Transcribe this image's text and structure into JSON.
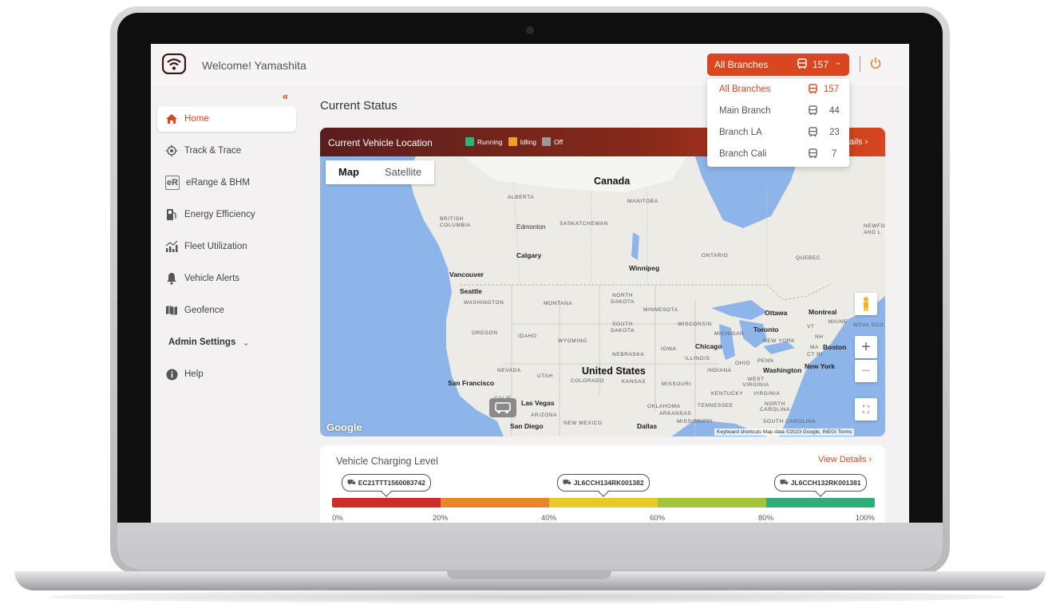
{
  "header": {
    "welcome": "Welcome! Yamashita",
    "branch_selector": {
      "label": "All Branches",
      "count": "157"
    }
  },
  "dropdown": {
    "items": [
      {
        "name": "All Branches",
        "count": "157",
        "selected": true
      },
      {
        "name": "Main Branch",
        "count": "44"
      },
      {
        "name": "Branch LA",
        "count": "23"
      },
      {
        "name": "Branch Cali",
        "count": "7"
      }
    ]
  },
  "sidebar": {
    "collapse": "«",
    "items": [
      {
        "label": "Home",
        "icon": "home-icon",
        "active": true
      },
      {
        "label": "Track & Trace",
        "icon": "target-icon"
      },
      {
        "label": "eRange & BHM",
        "icon": "erange-icon"
      },
      {
        "label": "Energy Efficiency",
        "icon": "fuel-icon"
      },
      {
        "label": "Fleet Utilization",
        "icon": "chart-icon"
      },
      {
        "label": "Vehicle Alerts",
        "icon": "bell-icon"
      },
      {
        "label": "Geofence",
        "icon": "map-icon"
      },
      {
        "label": "Admin Settings",
        "icon": "chevron-down-icon"
      },
      {
        "label": "Help",
        "icon": "info-icon"
      }
    ]
  },
  "main": {
    "title": "Current Status",
    "map_card": {
      "title": "Current Vehicle Location",
      "legend": [
        "Running",
        "Idling",
        "Off"
      ],
      "legend_colors": [
        "#2fb37a",
        "#f0a020",
        "#9a9a9a"
      ],
      "details_link": "tails ›",
      "tabs": [
        "Map",
        "Satellite"
      ],
      "google": "Google",
      "attribution": "Keyboard shortcuts   Map data ©2023 Google, INEGI   Terms",
      "labels": {
        "canada": "Canada",
        "us": "United States",
        "alberta": "ALBERTA",
        "manitoba": "MANITOBA",
        "bc": "BRITISH COLUMBIA",
        "sask": "SASKATCHEWAN",
        "ontario": "ONTARIO",
        "quebec": "QUEBEC",
        "edmonton": "Edmonton",
        "calgary": "Calgary",
        "winnipeg": "Winnipeg",
        "vancouver": "Vancouver",
        "seattle": "Seattle",
        "washington": "WASHINGTON",
        "montana": "MONTANA",
        "nd": "NORTH DAKOTA",
        "minnesota": "MINNESOTA",
        "ottawa": "Ottawa",
        "montreal": "Montreal",
        "oregon": "OREGON",
        "idaho": "IDAHO",
        "wyoming": "WYOMING",
        "sd": "SOUTH DAKOTA",
        "wisconsin": "WISCONSIN",
        "michigan": "MICHIGAN",
        "toronto": "Toronto",
        "ny": "NEW YORK",
        "boston": "Boston",
        "nebraska": "NEBRASKA",
        "iowa": "IOWA",
        "chicago": "Chicago",
        "illinois": "ILLINOIS",
        "ohio": "OHIO",
        "penn": "PENN",
        "nevada": "NEVADA",
        "utah": "UTAH",
        "colorado": "COLORADO",
        "kansas": "KANSAS",
        "missouri": "MISSOURI",
        "indiana": "INDIANA",
        "dc": "Washington",
        "nyc": "New York",
        "sf": "San Francisco",
        "lasvegas": "Las Vegas",
        "kentucky": "KENTUCKY",
        "virginia": "VIRGINIA",
        "wv": "WEST VIRGINIA",
        "arizona": "ARIZONA",
        "nm": "NEW MEXICO",
        "oklahoma": "OKLAHOMA",
        "tennessee": "TENNESSEE",
        "nc": "NORTH CAROLINA",
        "sandiego": "San Diego",
        "dallas": "Dallas",
        "arkansas": "ARKANSAS",
        "mississippi": "MISSISSIPPI",
        "sc": "SOUTH CAROLINA",
        "la": "Lo",
        "cali": "CALIF",
        "vt": "VT",
        "maine": "MAINE",
        "nova": "NOVA SCO",
        "newf": "NEWFO AND L",
        "nh": "NH",
        "ma": "MA",
        "ct": "CT RI"
      }
    },
    "charging_card": {
      "title": "Vehicle Charging Level",
      "link": "View Details ›",
      "vehicles": [
        {
          "id": "EC21TTT1560083742",
          "level": 10
        },
        {
          "id": "JL6CCH134RK001382",
          "level": 50
        },
        {
          "id": "JL6CCH132RK001381",
          "level": 90
        }
      ],
      "segment_colors": [
        "#cf2b2b",
        "#e8862a",
        "#e8c92a",
        "#a3c43a",
        "#2fae7c"
      ],
      "ticks": [
        "0%",
        "20%",
        "40%",
        "60%",
        "80%",
        "100%"
      ]
    }
  },
  "colors": {
    "accent": "#d9461f",
    "header_dark": "#5a1d1d"
  }
}
